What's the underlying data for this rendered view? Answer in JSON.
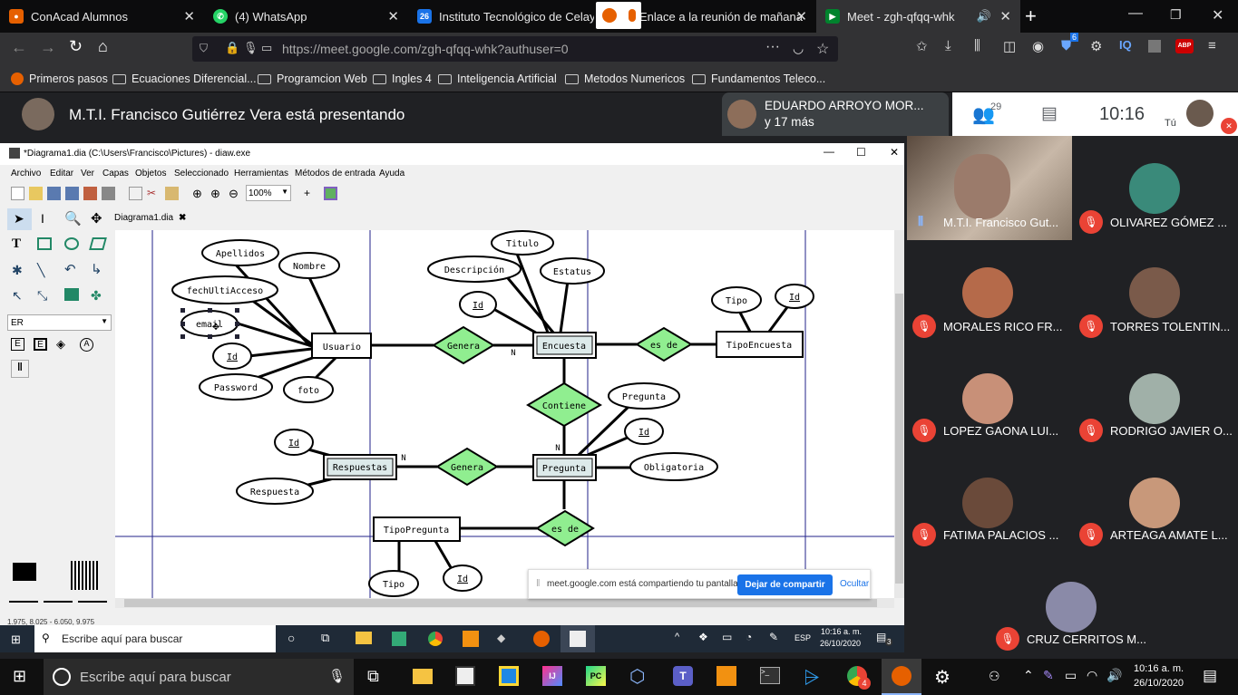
{
  "tabs": [
    {
      "label": "ConAcad Alumnos",
      "active": false
    },
    {
      "label": "(4) WhatsApp",
      "active": false
    },
    {
      "label": "Instituto Tecnológico de Celaya",
      "active": false
    },
    {
      "label": "Enlace a la reunión de mañana",
      "active": false
    },
    {
      "label": "Meet - zgh-qfqq-whk",
      "active": true
    }
  ],
  "tab_badge": "26",
  "url": "https://meet.google.com/zgh-qfqq-whk?authuser=0",
  "url_domain": "meet.google.com",
  "bookmarks": [
    "Primeros pasos",
    "Ecuaciones Diferencial...",
    "Programcion Web",
    "Ingles 4",
    "Inteligencia Artificial",
    "Metodos Numericos",
    "Fundamentos Teleco..."
  ],
  "ext_badge": "6",
  "ext_labels": {
    "iq": "IQ",
    "abp": "ABP"
  },
  "meet": {
    "presenting": "M.T.I. Francisco Gutiérrez Vera está presentando",
    "top_participant": "EDUARDO ARROYO MOR...",
    "more": "y 17 más",
    "people_count": "29",
    "time": "10:16",
    "you": "Tú",
    "share_notice": "meet.google.com está compartiendo tu pantalla.",
    "stop_sharing": "Dejar de compartir",
    "hide": "Ocultar"
  },
  "participants": [
    {
      "name": "M.T.I. Francisco Gut...",
      "muted": false
    },
    {
      "name": "OLIVAREZ GÓMEZ ...",
      "muted": true
    },
    {
      "name": "MORALES RICO FR...",
      "muted": true
    },
    {
      "name": "TORRES TOLENTIN...",
      "muted": true
    },
    {
      "name": "LOPEZ GAONA LUI...",
      "muted": true
    },
    {
      "name": "RODRIGO JAVIER O...",
      "muted": true
    },
    {
      "name": "FATIMA PALACIOS ...",
      "muted": true
    },
    {
      "name": "ARTEAGA AMATE L...",
      "muted": true
    },
    {
      "name": "CRUZ CERRITOS M...",
      "muted": true
    }
  ],
  "dia": {
    "title": "*Diagrama1.dia (C:\\Users\\Francisco\\Pictures) - diaw.exe",
    "menus": [
      "Archivo",
      "Editar",
      "Ver",
      "Capas",
      "Objetos",
      "Seleccionado",
      "Herramientas",
      "Métodos de entrada",
      "Ayuda"
    ],
    "zoom": "100%",
    "tab": "Diagrama1.dia",
    "sheet": "ER",
    "status": "1.975, 8.025 - 6.050, 9.975"
  },
  "er": {
    "entities": [
      "Usuario",
      "Encuesta",
      "TipoEncuesta",
      "Respuestas",
      "Pregunta",
      "TipoPregunta"
    ],
    "relationships": [
      "Genera",
      "es de",
      "Contiene",
      "Genera",
      "es de"
    ],
    "attributes": [
      "Apellidos",
      "Nombre",
      "fechUltiAcceso",
      "email",
      "Id",
      "Password",
      "foto",
      "Titulo",
      "Descripción",
      "Estatus",
      "Id",
      "Tipo",
      "Id",
      "Pregunta",
      "Id",
      "Obligatoria",
      "Id",
      "Respuesta",
      "Tipo",
      "Id"
    ],
    "cardinalities": [
      "N",
      "N",
      "N"
    ]
  },
  "taskbar_small": {
    "search": "Escribe aquí para buscar",
    "lang": "ESP",
    "time": "10:16 a. m.",
    "date": "26/10/2020",
    "notif": "3"
  },
  "taskbar": {
    "search": "Escribe aquí para buscar",
    "time": "10:16 a. m.",
    "date": "26/10/2020",
    "badge": "4",
    "ps": ">_"
  },
  "colors": {
    "relationship": "#90ee90",
    "meet_bg": "#202124",
    "accent": "#1a73e8",
    "mute": "#ea4335"
  }
}
